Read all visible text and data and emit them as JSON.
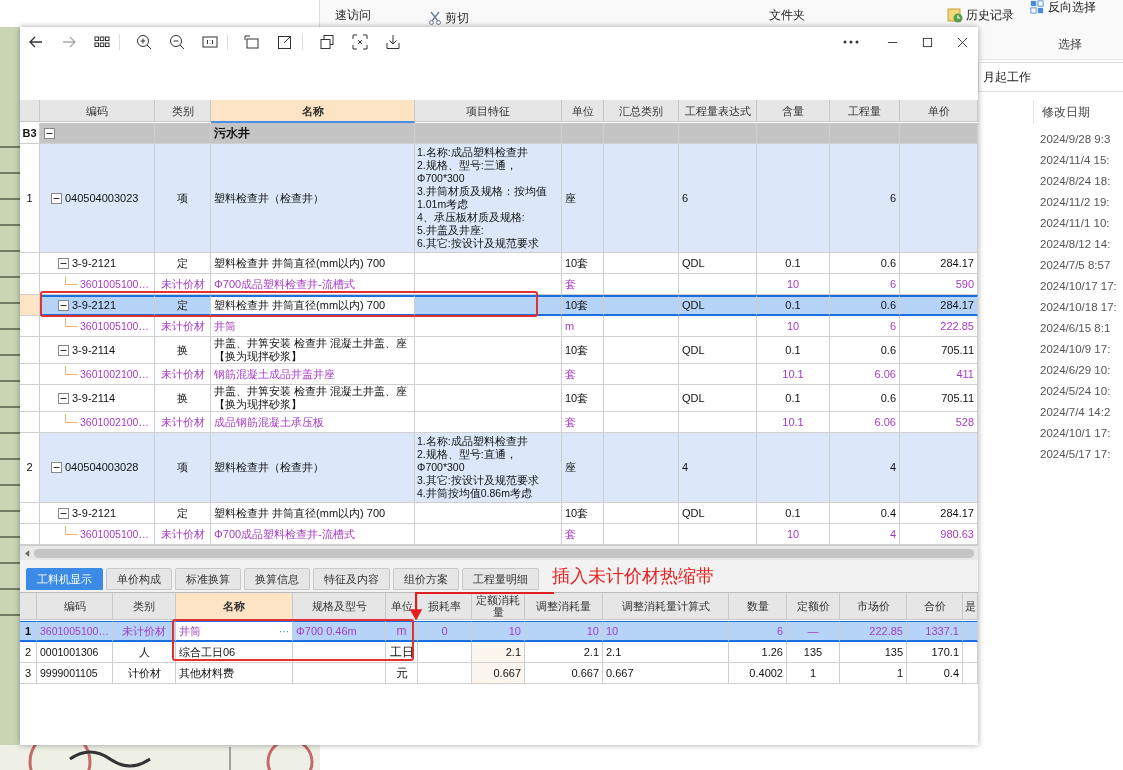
{
  "explorer": {
    "ribbon": {
      "quick_access": "速访问",
      "cut": "剪切",
      "folder": "文件夹",
      "history": "历史记录",
      "invert_selection": "反向选择",
      "group_label": "选择"
    },
    "breadcrumb": "月起工作",
    "column_header": "修改日期",
    "dates": [
      "2024/9/28 9:3",
      "2024/11/4 15:",
      "2024/8/24 18:",
      "2024/11/2 19:",
      "2024/11/1 10:",
      "2024/8/12 14:",
      "2024/7/5 8:57",
      "2024/10/17 17:",
      "2024/10/18 17:",
      "2024/6/15 8:1",
      "2024/10/9 17:",
      "2024/6/29 10:",
      "2024/5/24 10:",
      "2024/7/4 14:2",
      "2024/10/1 17:",
      "2024/5/17 17:"
    ]
  },
  "image": {
    "top_table": {
      "columns": [
        "编码",
        "类别",
        "名称",
        "项目特征",
        "单位",
        "汇总类别",
        "工程量表达式",
        "含量",
        "工程量",
        "单价"
      ],
      "rows": [
        {
          "kind": "section",
          "selected": false,
          "num": "B3",
          "name": "污水井",
          "children": [
            {
              "kind": "item",
              "selected": false,
              "num": "1",
              "code": "040504003023",
              "type": "项",
              "name": "塑料检查井（检查井）",
              "features": "1.名称:成品塑料检查井\n2.规格、型号:三通，\nΦ700*300\n3.井筒材质及规格：按均值\n1.01m考虑\n4、承压板材质及规格:\n5.井盖及井座:\n6.其它:按设计及规范要求",
              "unit": "座",
              "expr": "6",
              "qty": "6",
              "children": [
                {
                  "kind": "quota",
                  "selected": false,
                  "code": "3-9-2121",
                  "type": "定",
                  "name": "塑料检查井 井筒直径(mm以内) 700",
                  "unit": "10套",
                  "expr": "QDL",
                  "content": "0.1",
                  "qty": "0.6",
                  "price": "284.17",
                  "children": [
                    {
                      "kind": "material",
                      "selected": false,
                      "code": "3601005100…",
                      "type": "未计价材",
                      "name": "Φ700成品塑料检查井-流槽式",
                      "unit": "套",
                      "content": "10",
                      "qty": "6",
                      "price": "590"
                    }
                  ]
                },
                {
                  "kind": "quota",
                  "selected": true,
                  "code": "3-9-2121",
                  "type": "定",
                  "name": "塑料检查井 井筒直径(mm以内) 700",
                  "unit": "10套",
                  "expr": "QDL",
                  "content": "0.1",
                  "qty": "0.6",
                  "price": "284.17",
                  "children": [
                    {
                      "kind": "material",
                      "selected": false,
                      "code": "3601005100…",
                      "type": "未计价材",
                      "name": "井筒",
                      "unit": "m",
                      "content": "10",
                      "qty": "6",
                      "price": "222.85"
                    }
                  ]
                },
                {
                  "kind": "quota",
                  "selected": false,
                  "code": "3-9-2114",
                  "type": "换",
                  "name": "井盖、井箅安装 检查井 混凝土井盖、座【换为现拌砂浆】",
                  "unit": "10套",
                  "expr": "QDL",
                  "content": "0.1",
                  "qty": "0.6",
                  "price": "705.11",
                  "children": [
                    {
                      "kind": "material",
                      "selected": false,
                      "code": "3601002100…",
                      "type": "未计价材",
                      "name": "钢筋混凝土成品井盖井座",
                      "unit": "套",
                      "content": "10.1",
                      "qty": "6.06",
                      "price": "411"
                    }
                  ]
                },
                {
                  "kind": "quota",
                  "selected": false,
                  "code": "3-9-2114",
                  "type": "换",
                  "name": "井盖、井箅安装 检查井 混凝土井盖、座【换为现拌砂浆】",
                  "unit": "10套",
                  "expr": "QDL",
                  "content": "0.1",
                  "qty": "0.6",
                  "price": "705.11",
                  "children": [
                    {
                      "kind": "material",
                      "selected": false,
                      "code": "3601002100…",
                      "type": "未计价材",
                      "name": "成品钢筋混凝土承压板",
                      "unit": "套",
                      "content": "10.1",
                      "qty": "6.06",
                      "price": "528"
                    }
                  ]
                }
              ]
            },
            {
              "kind": "item",
              "selected": false,
              "num": "2",
              "code": "040504003028",
              "type": "项",
              "name": "塑料检查井（检查井）",
              "features": "1.名称:成品塑料检查井\n2.规格、型号:直通，\nΦ700*300\n3.其它:按设计及规范要求\n4.井筒按均值0.86m考虑",
              "unit": "座",
              "expr": "4",
              "qty": "4",
              "children": [
                {
                  "kind": "quota",
                  "selected": false,
                  "code": "3-9-2121",
                  "type": "定",
                  "name": "塑料检查井 井筒直径(mm以内) 700",
                  "unit": "10套",
                  "expr": "QDL",
                  "content": "0.1",
                  "qty": "0.4",
                  "price": "284.17",
                  "children": [
                    {
                      "kind": "material",
                      "selected": false,
                      "code": "3601005100…",
                      "type": "未计价材",
                      "name": "Φ700成品塑料检查井-流槽式",
                      "unit": "套",
                      "content": "10",
                      "qty": "4",
                      "price": "980.63"
                    }
                  ]
                }
              ]
            }
          ]
        }
      ]
    },
    "tabs": [
      {
        "label": "工料机显示",
        "selected": true
      },
      {
        "label": "单价构成",
        "selected": false
      },
      {
        "label": "标准换算",
        "selected": false
      },
      {
        "label": "换算信息",
        "selected": false
      },
      {
        "label": "特征及内容",
        "selected": false
      },
      {
        "label": "组价方案",
        "selected": false
      },
      {
        "label": "工程量明细",
        "selected": false
      }
    ],
    "bottom_table": {
      "columns": [
        "编码",
        "类别",
        "名称",
        "规格及型号",
        "单位",
        "损耗率",
        "定额消耗量",
        "调整消耗量",
        "调整消耗量计算式",
        "数量",
        "定额价",
        "市场价",
        "合价",
        "是"
      ],
      "rows": [
        {
          "kind": "material",
          "selected": true,
          "num": "1",
          "code": "3601005100…",
          "type": "未计价材",
          "name": "井筒",
          "edit_button": "···",
          "spec": "Φ700 0.46m",
          "unit": "m",
          "loss": "0",
          "quota_qty": "10",
          "adj_qty": "10",
          "formula": "10",
          "qty": "6",
          "quota_price": "—",
          "market_price": "222.85",
          "total": "1337.1"
        },
        {
          "kind": "labor",
          "selected": false,
          "num": "2",
          "code": "0001001306",
          "type": "人",
          "name": "综合工日06",
          "unit": "工日",
          "quota_qty": "2.1",
          "adj_qty": "2.1",
          "formula": "2.1",
          "qty": "1.26",
          "quota_price": "135",
          "market_price": "135",
          "total": "170.1"
        },
        {
          "kind": "priced",
          "selected": false,
          "num": "3",
          "code": "9999001105",
          "type": "计价材",
          "name": "其他材料费",
          "unit": "元",
          "quota_qty": "0.667",
          "adj_qty": "0.667",
          "formula": "0.667",
          "qty": "0.4002",
          "quota_price": "1",
          "market_price": "1",
          "total": "0.4"
        }
      ]
    },
    "annotation": "插入未计价材热缩带"
  }
}
